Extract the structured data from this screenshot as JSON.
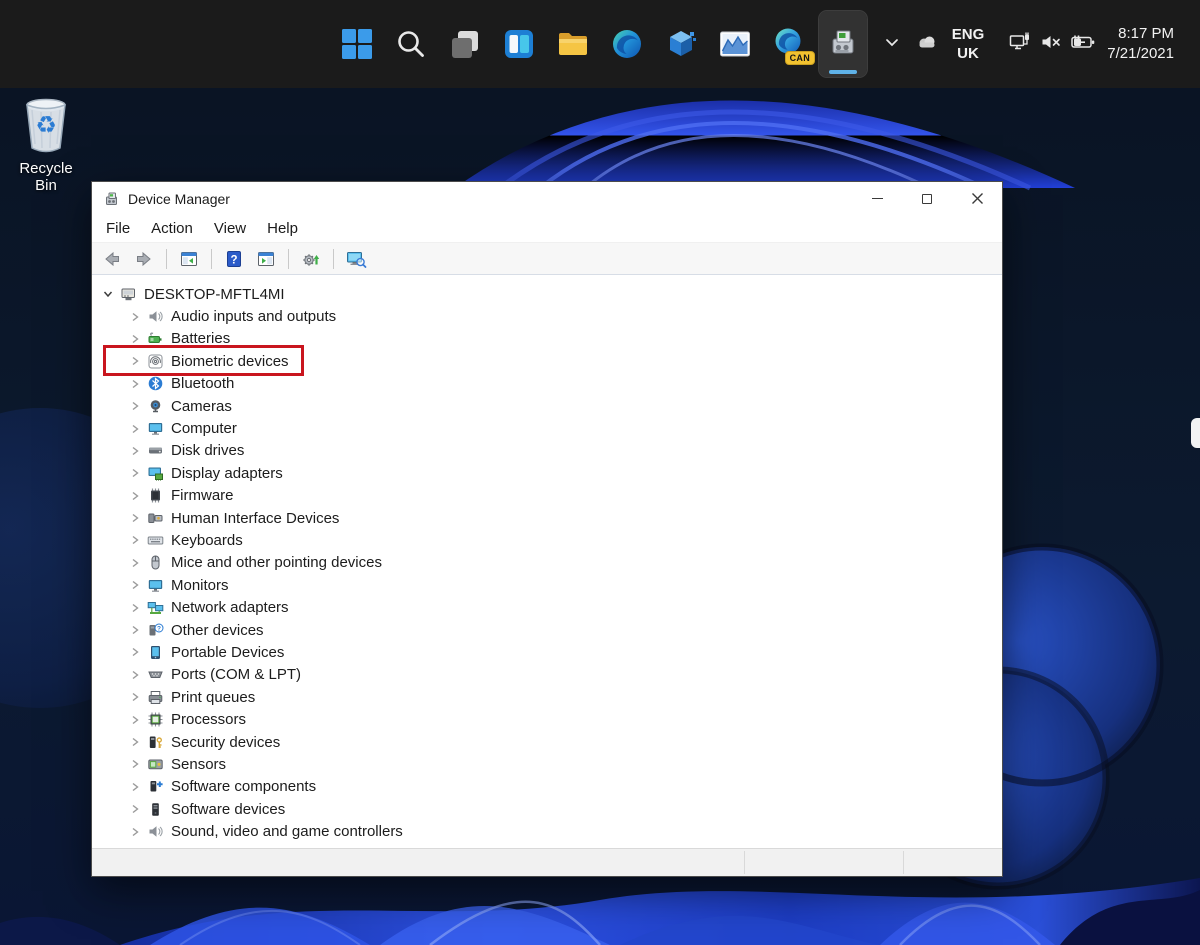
{
  "taskbar": {
    "apps": [
      {
        "name": "start",
        "icon": "start"
      },
      {
        "name": "search",
        "icon": "search"
      },
      {
        "name": "task-view",
        "icon": "task-view"
      },
      {
        "name": "widgets",
        "icon": "widgets"
      },
      {
        "name": "file-explorer",
        "icon": "file-explorer"
      },
      {
        "name": "edge",
        "icon": "edge"
      },
      {
        "name": "3d-viewer",
        "icon": "cube"
      },
      {
        "name": "performance-monitor",
        "icon": "chart"
      },
      {
        "name": "edge-canary",
        "icon": "edge-canary",
        "badge": "CAN"
      },
      {
        "name": "device-manager",
        "icon": "device-manager",
        "active": true
      }
    ],
    "tray": {
      "language": [
        "ENG",
        "UK"
      ],
      "time": "8:17 PM",
      "date": "7/21/2021",
      "icons": [
        "chevron-down-icon",
        "onedrive-cloud-icon",
        "network-icon",
        "volume-muted-icon",
        "battery-charging-icon"
      ]
    }
  },
  "desktop": {
    "recycle_bin_label": "Recycle Bin"
  },
  "window": {
    "title": "Device Manager",
    "menu": [
      "File",
      "Action",
      "View",
      "Help"
    ],
    "controls": [
      "minimize",
      "maximize",
      "close"
    ],
    "toolbar_icons": [
      "back",
      "forward",
      "show-console-tree",
      "help",
      "show-action-pane",
      "update-driver",
      "scan-hardware-changes"
    ],
    "tree": {
      "root": "DESKTOP-MFTL4MI",
      "items": [
        {
          "label": "Audio inputs and outputs",
          "icon": "speaker"
        },
        {
          "label": "Batteries",
          "icon": "battery"
        },
        {
          "label": "Biometric devices",
          "icon": "fingerprint",
          "highlighted": true
        },
        {
          "label": "Bluetooth",
          "icon": "bluetooth"
        },
        {
          "label": "Cameras",
          "icon": "camera"
        },
        {
          "label": "Computer",
          "icon": "monitor"
        },
        {
          "label": "Disk drives",
          "icon": "disk"
        },
        {
          "label": "Display adapters",
          "icon": "display-adapter"
        },
        {
          "label": "Firmware",
          "icon": "firmware"
        },
        {
          "label": "Human Interface Devices",
          "icon": "hid"
        },
        {
          "label": "Keyboards",
          "icon": "keyboard"
        },
        {
          "label": "Mice and other pointing devices",
          "icon": "mouse"
        },
        {
          "label": "Monitors",
          "icon": "monitor"
        },
        {
          "label": "Network adapters",
          "icon": "network"
        },
        {
          "label": "Other devices",
          "icon": "unknown-device"
        },
        {
          "label": "Portable Devices",
          "icon": "portable-device"
        },
        {
          "label": "Ports (COM & LPT)",
          "icon": "serial-port"
        },
        {
          "label": "Print queues",
          "icon": "printer"
        },
        {
          "label": "Processors",
          "icon": "processor"
        },
        {
          "label": "Security devices",
          "icon": "security-device"
        },
        {
          "label": "Sensors",
          "icon": "sensor"
        },
        {
          "label": "Software components",
          "icon": "software-component"
        },
        {
          "label": "Software devices",
          "icon": "software-device"
        },
        {
          "label": "Sound, video and game controllers",
          "icon": "speaker"
        }
      ]
    },
    "annotation": {
      "target": "Biometric devices",
      "color": "#c9151e"
    }
  }
}
